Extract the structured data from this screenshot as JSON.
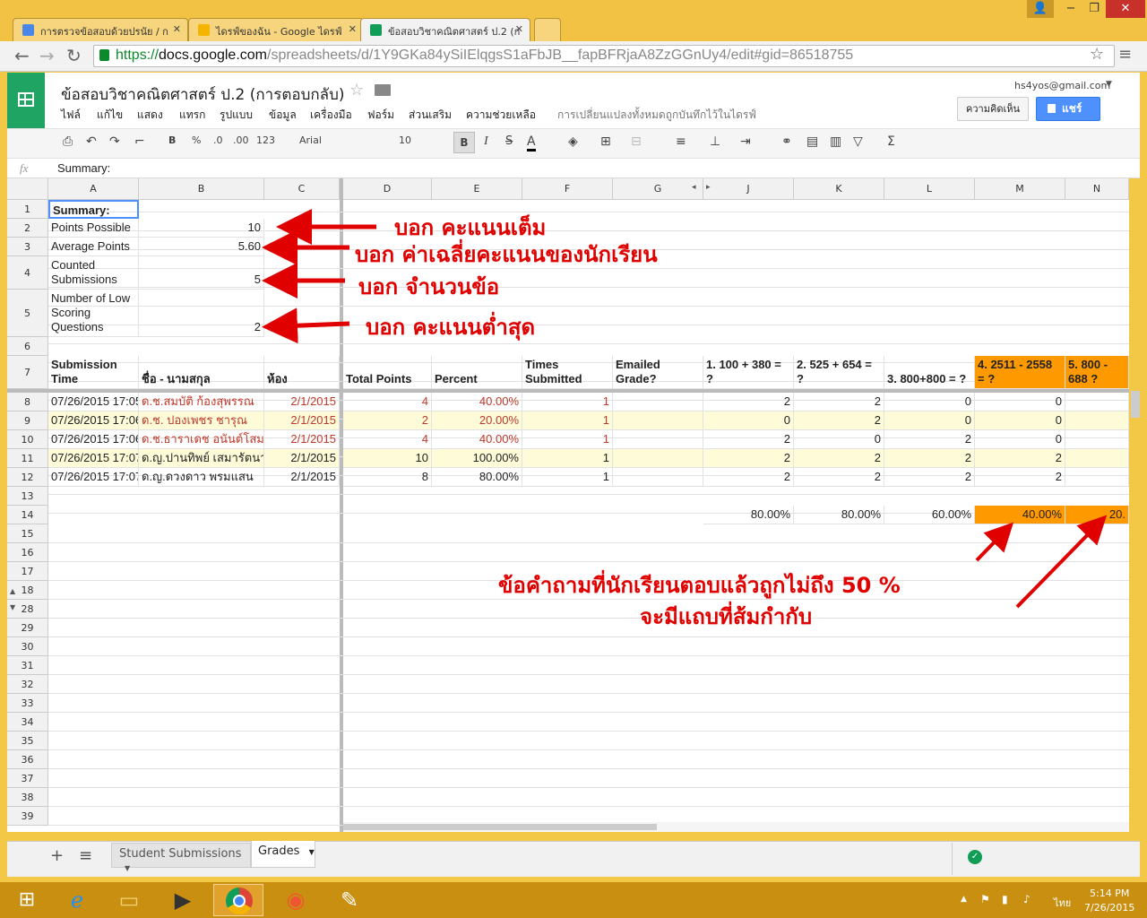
{
  "browser": {
    "tabs": [
      {
        "label": "การตรวจข้อสอบด้วยปรนัย / ก",
        "favicon_color": "#4a86e8"
      },
      {
        "label": "ไดรฟ์ของฉัน - Google ไดรฟ์",
        "favicon_color": "#f4b400"
      },
      {
        "label": "ข้อสอบวิชาคณิตศาสตร์ ป.2 (ก",
        "favicon_color": "#0f9d58"
      }
    ],
    "url_scheme": "https://",
    "url_host": "docs.google.com",
    "url_path": "/spreadsheets/d/1Y9GKa84ySiIElqgsS1aFbJB__fapBFRjaA8ZzGGnUy4/edit#gid=86518755"
  },
  "doc": {
    "title": "ข้อสอบวิชาคณิตศาสตร์ ป.2 (การตอบกลับ)",
    "account": "hs4yos@gmail.com",
    "comments_label": "ความคิดเห็น",
    "share_label": "แชร์",
    "save_status": "การเปลี่ยนแปลงทั้งหมดถูกบันทึกไว้ในไดรฟ์",
    "menus": [
      "ไฟล์",
      "แก้ไข",
      "แสดง",
      "แทรก",
      "รูปแบบ",
      "ข้อมูล",
      "เครื่องมือ",
      "ฟอร์ม",
      "ส่วนเสริม",
      "ความช่วยเหลือ"
    ]
  },
  "toolbar": {
    "bold": "B",
    "percent": "%",
    "dec_less": ".0",
    "dec_more": ".00",
    "format_more": "123",
    "font": "Arial",
    "size": "10",
    "italic": "I",
    "strike": "S",
    "textcolor": "A",
    "sum": "Σ"
  },
  "formula": {
    "fx": "fx",
    "content": "Summary:"
  },
  "columns": [
    "A",
    "B",
    "C",
    "D",
    "E",
    "F",
    "G",
    "J",
    "K",
    "L",
    "M",
    "N"
  ],
  "rows": {
    "r1": {
      "num": "1",
      "a": "Summary:"
    },
    "r2": {
      "num": "2",
      "a": "Points Possible",
      "b": "10"
    },
    "r3": {
      "num": "3",
      "a": "Average Points",
      "b": "5.60"
    },
    "r4": {
      "num": "4",
      "a": "Counted Submissions",
      "b": "5"
    },
    "r5": {
      "num": "5",
      "a": "Number of Low Scoring Questions",
      "b": "2"
    },
    "r6": {
      "num": "6"
    },
    "r7": {
      "num": "7",
      "a": "Submission Time",
      "b": "ชื่อ - นามสกุล",
      "c": "ห้อง",
      "d": "Total Points",
      "e": "Percent",
      "f": "Times Submitted",
      "g": "Emailed Grade?",
      "j": "1.  100 + 380  = ?",
      "k": "2. 525 + 654  = ?",
      "l": "3. 800+800 = ?",
      "m": "4. 2511 - 2558 = ?",
      "n": "5. 800 - 688 ?"
    },
    "data": [
      {
        "num": "8",
        "a": "07/26/2015 17:05",
        "b": "ด.ช.สมบัติ ก้องสุพรรณ",
        "c": "2/1/2015",
        "d": "4",
        "e": "40.00%",
        "f": "1",
        "j": "2",
        "k": "2",
        "l": "0",
        "m": "0",
        "n": ""
      },
      {
        "num": "9",
        "a": "07/26/2015 17:06",
        "b": "ด.ช. ปองเพชร ชารุณ",
        "c": "2/1/2015",
        "d": "2",
        "e": "20.00%",
        "f": "1",
        "j": "0",
        "k": "2",
        "l": "0",
        "m": "0",
        "n": ""
      },
      {
        "num": "10",
        "a": "07/26/2015 17:06",
        "b": "ด.ช.ธาราเดช อนันต์โสม",
        "c": "2/1/2015",
        "d": "4",
        "e": "40.00%",
        "f": "1",
        "j": "2",
        "k": "0",
        "l": "2",
        "m": "0",
        "n": ""
      },
      {
        "num": "11",
        "a": "07/26/2015 17:07",
        "b": "ด.ญ.ปานทิพย์  เสมารัตนา",
        "c": "2/1/2015",
        "d": "10",
        "e": "100.00%",
        "f": "1",
        "j": "2",
        "k": "2",
        "l": "2",
        "m": "2",
        "n": ""
      },
      {
        "num": "12",
        "a": "07/26/2015 17:07",
        "b": "ด.ญ.ดวงดาว  พรมแสน",
        "c": "2/1/2015",
        "d": "8",
        "e": "80.00%",
        "f": "1",
        "j": "2",
        "k": "2",
        "l": "2",
        "m": "2",
        "n": ""
      }
    ],
    "r13": {
      "num": "13"
    },
    "r14": {
      "num": "14",
      "j": "80.00%",
      "k": "80.00%",
      "l": "60.00%",
      "m": "40.00%",
      "n": "20."
    },
    "empty_rows": [
      "15",
      "16",
      "17",
      "18",
      "28",
      "29",
      "30",
      "31",
      "32",
      "33",
      "34",
      "35",
      "36",
      "37",
      "38",
      "39"
    ]
  },
  "annotations": {
    "a1": "บอก คะแนนเต็ม",
    "a2": "บอก ค่าเฉลี่ยคะแนนของนักเรียน",
    "a3": "บอก จำนวนข้อ",
    "a4": "บอก คะแนนต่ำสุด",
    "a5": "ข้อคำถามที่นักเรียนตอบแล้วถูกไม่ถึง 50 %",
    "a6": "จะมีแถบที่ส้มกำกับ"
  },
  "sheets": [
    {
      "label": "Student Submissions"
    },
    {
      "label": "Grades"
    }
  ],
  "taskbar": {
    "lang": "ไทย",
    "time": "5:14 PM",
    "date": "7/26/2015"
  },
  "colors": {
    "accent_orange": "#ff9900",
    "annotation_red": "#e00000",
    "share_blue": "#4d90fe",
    "sheets_green": "#1fa463"
  }
}
